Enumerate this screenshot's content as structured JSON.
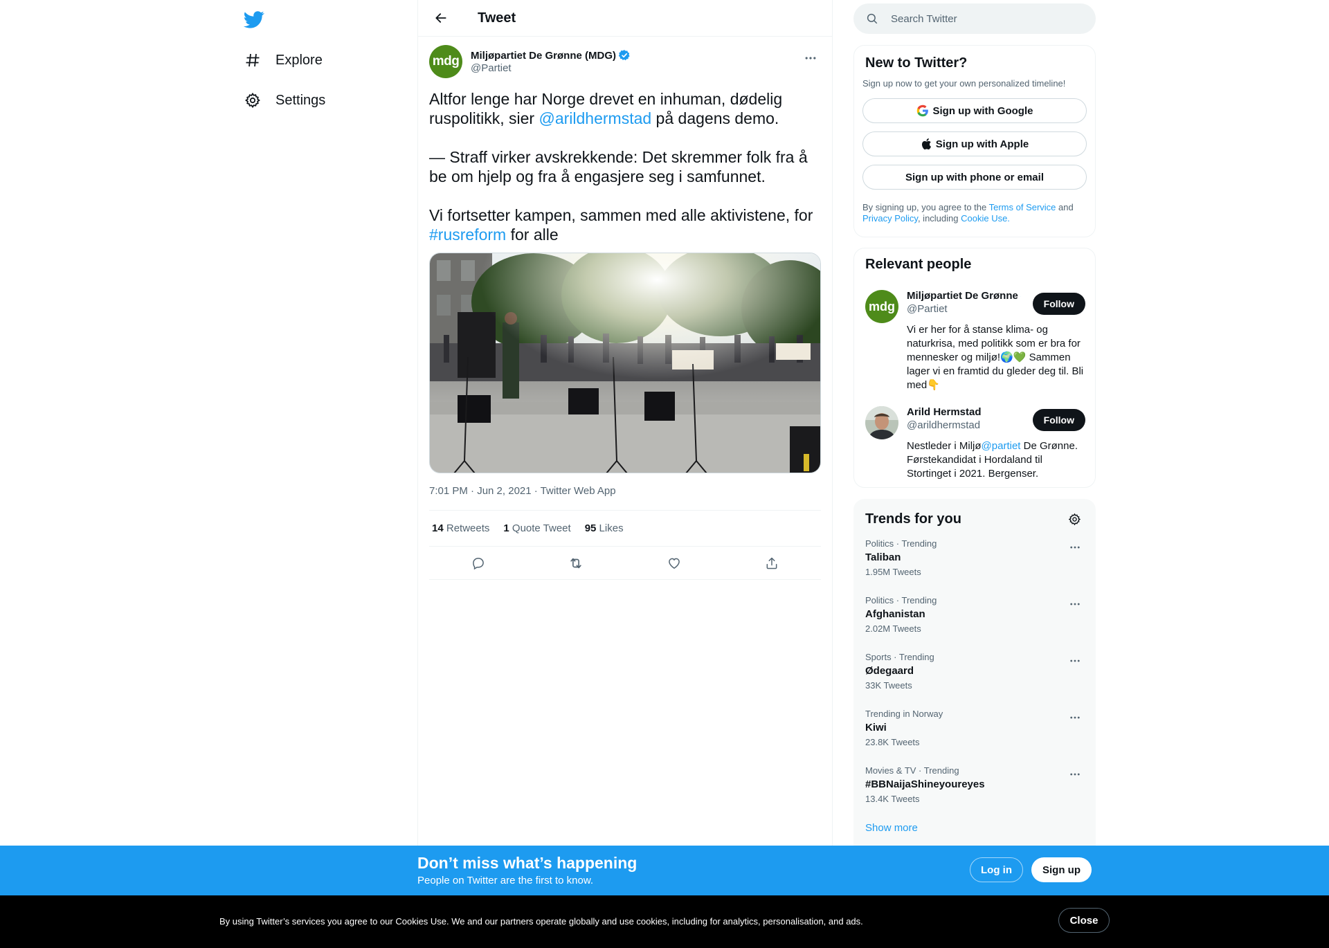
{
  "nav": {
    "logo_icon": "twitter-bird-icon",
    "items": [
      {
        "label": "Explore",
        "icon": "hashtag-icon"
      },
      {
        "label": "Settings",
        "icon": "gear-icon"
      }
    ]
  },
  "header": {
    "title": "Tweet",
    "back_icon": "arrow-left-icon"
  },
  "tweet": {
    "author_name": "Miljøpartiet De Grønne (MDG)",
    "author_handle": "@Partiet",
    "avatar_text": "mdg",
    "text_line1a": "Altfor lenge har Norge drevet en inhuman, dødelig",
    "text_line1b_pre": "ruspolitikk, sier ",
    "text_mention": "@arildhermstad",
    "text_line1b_post": " på dagens demo.",
    "text_para2": "— Straff virker avskrekkende: Det skremmer folk fra å be om hjelp og fra å engasjere seg i samfunnet.",
    "text_para3_pre": "Vi fortsetter kampen, sammen med alle aktivistene, for",
    "text_hashtag": "#rusreform",
    "text_para3_post": " for alle",
    "timestamp": "7:01 PM · Jun 2, 2021 · Twitter Web App",
    "stats": [
      {
        "count": "14",
        "label": "Retweets"
      },
      {
        "count": "1",
        "label": "Quote Tweet"
      },
      {
        "count": "95",
        "label": "Likes"
      }
    ],
    "actions": [
      "reply-icon",
      "retweet-icon",
      "like-icon",
      "share-icon"
    ]
  },
  "search": {
    "placeholder": "Search Twitter"
  },
  "new_to_twitter": {
    "title": "New to Twitter?",
    "subtitle": "Sign up now to get your own personalized timeline!",
    "google": "Sign up with Google",
    "apple": "Sign up with Apple",
    "phone": "Sign up with phone or email",
    "terms_pre": "By signing up, you agree to the ",
    "terms_tos": "Terms of Service",
    "terms_and": " and ",
    "terms_privacy": "Privacy Policy",
    "terms_including": ", including ",
    "terms_cookie": "Cookie Use."
  },
  "relevant": {
    "title": "Relevant people",
    "people": [
      {
        "name": "Miljøpartiet De Grønne",
        "handle": "@Partiet",
        "follow": "Follow",
        "avatar_text": "mdg",
        "bio": "Vi er her for å stanse klima- og naturkrisa, med politikk som er bra for mennesker og miljø!🌍💚 Sammen lager vi en framtid du gleder deg til. Bli med👇"
      },
      {
        "name": "Arild Hermstad",
        "handle": "@arildhermstad",
        "follow": "Follow",
        "bio_pre": "Nestleder i Miljø",
        "bio_link": "@partiet",
        "bio_post": " De Grønne. Førstekandidat i Hordaland til Stortinget i 2021. Bergenser."
      }
    ]
  },
  "trends": {
    "title": "Trends for you",
    "items": [
      {
        "meta": "Politics · Trending",
        "name": "Taliban",
        "count": "1.95M Tweets"
      },
      {
        "meta": "Politics · Trending",
        "name": "Afghanistan",
        "count": "2.02M Tweets"
      },
      {
        "meta": "Sports · Trending",
        "name": "Ødegaard",
        "count": "33K Tweets"
      },
      {
        "meta": "Trending in Norway",
        "name": "Kiwi",
        "count": "23.8K Tweets"
      },
      {
        "meta": "Movies & TV · Trending",
        "name": "#BBNaijaShineyoureyes",
        "count": "13.4K Tweets"
      }
    ],
    "show_more": "Show more"
  },
  "promo": {
    "title": "Don’t miss what’s happening",
    "subtitle": "People on Twitter are the first to know.",
    "login": "Log in",
    "signup": "Sign up"
  },
  "cookie": {
    "text": "By using Twitter’s services you agree to our Cookies Use. We and our partners operate globally and use cookies, including for analytics, personalisation, and ads.",
    "close": "Close"
  },
  "colors": {
    "accent": "#1d9bf0",
    "text": "#0f1419",
    "secondary": "#536471",
    "mdg_green": "#4e8b1a"
  }
}
